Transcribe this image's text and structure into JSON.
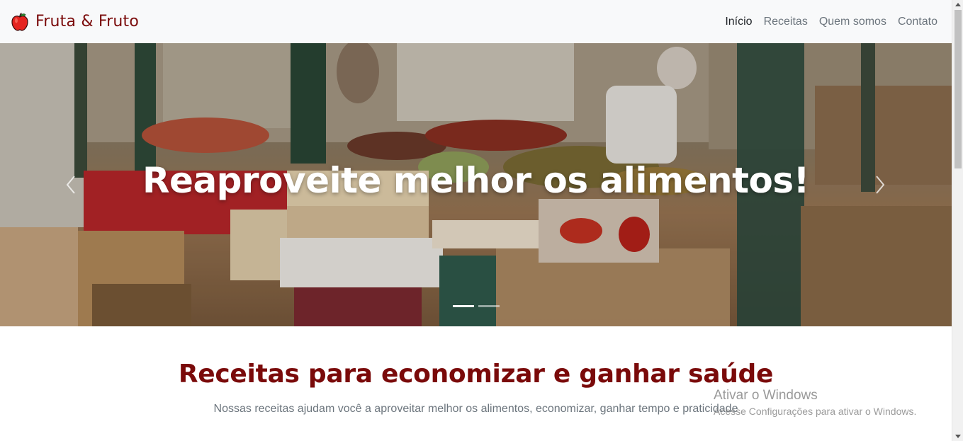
{
  "brand": {
    "name": "Fruta & Fruto",
    "icon": "apple-icon"
  },
  "nav": {
    "items": [
      {
        "label": "Início",
        "active": true
      },
      {
        "label": "Receitas",
        "active": false
      },
      {
        "label": "Quem somos",
        "active": false
      },
      {
        "label": "Contato",
        "active": false
      }
    ]
  },
  "carousel": {
    "caption": "Reaproveite melhor os alimentos!",
    "prev_icon": "chevron-left-icon",
    "next_icon": "chevron-right-icon",
    "slide_count": 2,
    "active_slide": 1
  },
  "section": {
    "title": "Receitas para economizar e ganhar saúde",
    "subtitle": "Nossas receitas ajudam você a aproveitar melhor os alimentos, economizar, ganhar tempo e praticidade"
  },
  "watermark": {
    "title": "Ativar o Windows",
    "subtitle": "Acesse Configurações para ativar o Windows."
  },
  "colors": {
    "brand": "#7a0a0a",
    "navbar_bg": "#f8f9fa",
    "nav_link": "#6c757d",
    "nav_active": "#212529"
  }
}
